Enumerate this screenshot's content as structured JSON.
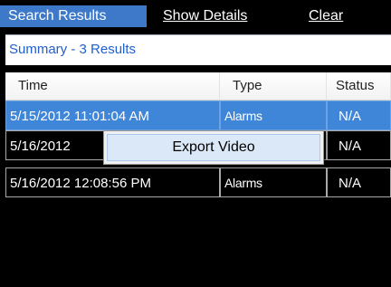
{
  "topbar": {
    "search_results": "Search Results",
    "show_details": "Show Details",
    "clear": "Clear"
  },
  "summary": {
    "text": "Summary - 3 Results"
  },
  "table": {
    "columns": [
      "Time",
      "Type",
      "Status"
    ],
    "rows": [
      {
        "time": "5/15/2012 11:01:04 AM",
        "type": "Alarms",
        "status": "N/A"
      },
      {
        "time": "5/16/2012",
        "type": "",
        "status": "N/A"
      },
      {
        "time": "5/16/2012 12:08:56 PM",
        "type": "Alarms",
        "status": "N/A"
      }
    ]
  },
  "context_menu": {
    "export_video": "Export Video"
  },
  "colors": {
    "selection": "#3f85d8",
    "tab_active": "#3d78c9",
    "summary_text": "#1f5fd0"
  }
}
